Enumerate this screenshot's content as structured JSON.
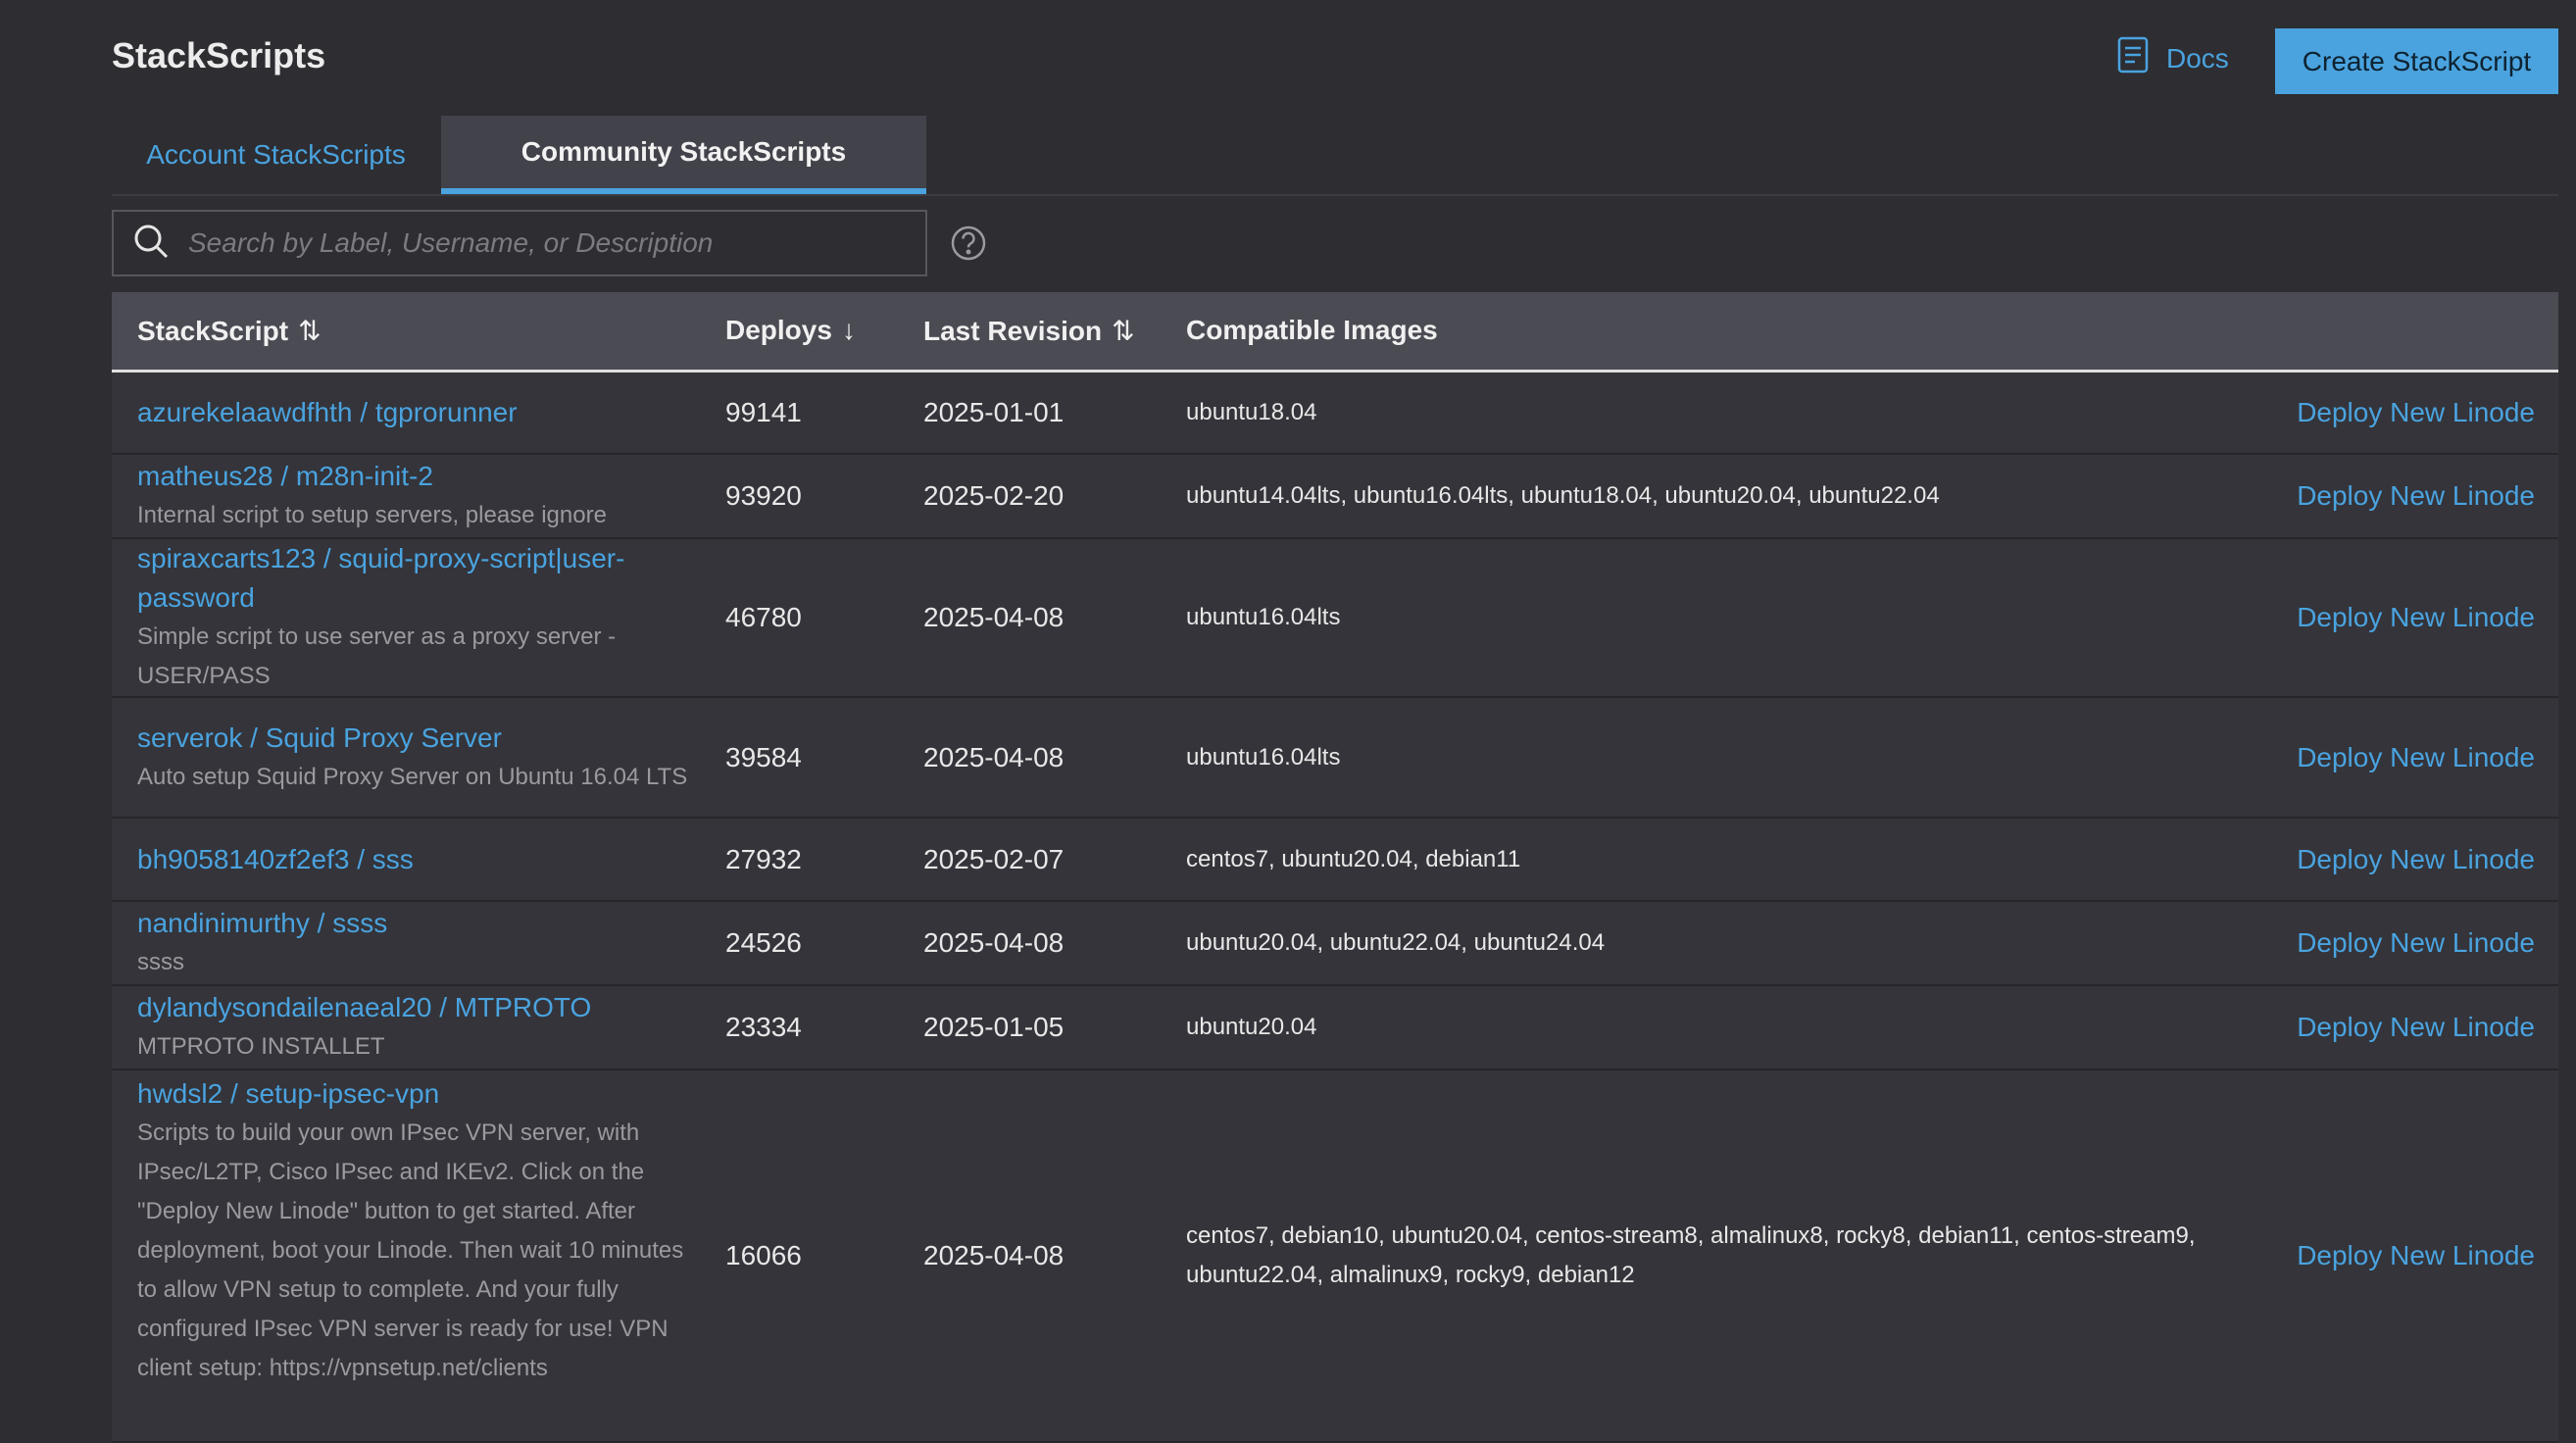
{
  "header": {
    "title": "StackScripts",
    "docs_label": "Docs",
    "create_label": "Create StackScript"
  },
  "tabs": [
    {
      "label": "Account StackScripts",
      "active": false
    },
    {
      "label": "Community StackScripts",
      "active": true
    }
  ],
  "search": {
    "placeholder": "Search by Label, Username, or Description",
    "value": ""
  },
  "table": {
    "columns": [
      "StackScript",
      "Deploys",
      "Last Revision",
      "Compatible Images"
    ],
    "action_label": "Deploy New Linode",
    "rows": [
      {
        "label": "azurekelaawdfhth / tgprorunner",
        "description": "",
        "deploys": "99141",
        "revision": "2025-01-01",
        "images": "ubuntu18.04"
      },
      {
        "label": "matheus28 / m28n-init-2",
        "description": "Internal script to setup servers, please ignore",
        "deploys": "93920",
        "revision": "2025-02-20",
        "images": "ubuntu14.04lts, ubuntu16.04lts, ubuntu18.04, ubuntu20.04, ubuntu22.04"
      },
      {
        "label": "spiraxcarts123 / squid-proxy-script|user-password",
        "description": "Simple script to use server as a proxy server - USER/PASS",
        "deploys": "46780",
        "revision": "2025-04-08",
        "images": "ubuntu16.04lts"
      },
      {
        "label": "serverok / Squid Proxy Server",
        "description": "Auto setup Squid Proxy Server on Ubuntu 16.04 LTS",
        "deploys": "39584",
        "revision": "2025-04-08",
        "images": "ubuntu16.04lts"
      },
      {
        "label": "bh9058140zf2ef3 / sss",
        "description": "",
        "deploys": "27932",
        "revision": "2025-02-07",
        "images": "centos7, ubuntu20.04, debian11"
      },
      {
        "label": "nandinimurthy / ssss",
        "description": "ssss",
        "deploys": "24526",
        "revision": "2025-04-08",
        "images": "ubuntu20.04, ubuntu22.04, ubuntu24.04"
      },
      {
        "label": "dylandysondailenaeal20 / MTPROTO",
        "description": "MTPROTO INSTALLET",
        "deploys": "23334",
        "revision": "2025-01-05",
        "images": "ubuntu20.04"
      },
      {
        "label": "hwdsl2 / setup-ipsec-vpn",
        "description": "Scripts to build your own IPsec VPN server, with IPsec/L2TP, Cisco IPsec and IKEv2. Click on the \"Deploy New Linode\" button to get started. After deployment, boot your Linode. Then wait 10 minutes to allow VPN setup to complete. And your fully configured IPsec VPN server is ready for use! VPN client setup: https://vpnsetup.net/clients",
        "deploys": "16066",
        "revision": "2025-04-08",
        "images": "centos7, debian10, ubuntu20.04, centos-stream8, almalinux8, rocky8, debian11, centos-stream9, ubuntu22.04, almalinux9, rocky9, debian12"
      }
    ]
  },
  "colors": {
    "accent": "#4aa3df",
    "background": "#2d2d32",
    "row": "#34343a",
    "header_row": "#4b4b53"
  }
}
